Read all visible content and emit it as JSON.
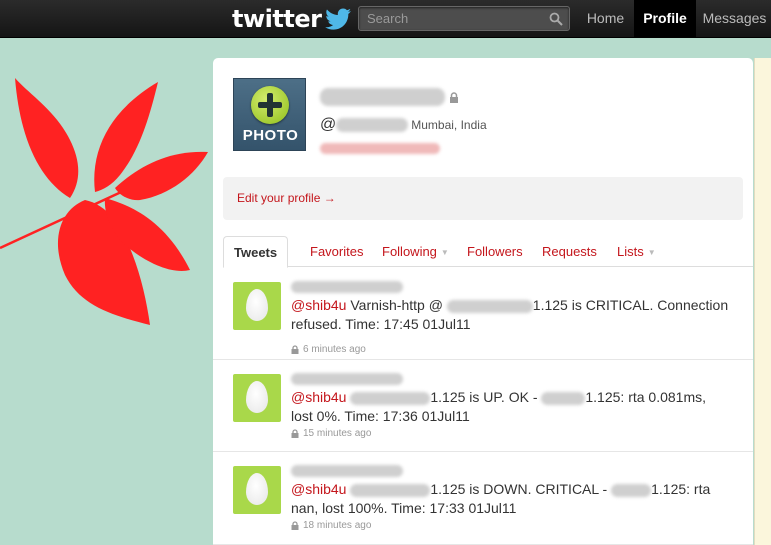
{
  "topbar": {
    "logo_text": "twitter",
    "search_placeholder": "Search",
    "nav": {
      "home": "Home",
      "profile": "Profile",
      "messages": "Messages"
    }
  },
  "profile": {
    "avatar_label": "PHOTO",
    "handle_prefix": "@",
    "location": "Mumbai, India",
    "edit_link": "Edit your profile →"
  },
  "tabs": [
    {
      "label": "Tweets"
    },
    {
      "label": "Favorites"
    },
    {
      "label": "Following"
    },
    {
      "label": "Followers"
    },
    {
      "label": "Requests"
    },
    {
      "label": "Lists"
    }
  ],
  "tweets": [
    {
      "mention": "@shib4u",
      "text_a": " Varnish-http @ ",
      "text_b": "1.125 is CRITICAL. Connection refused. Time: 17:45 01Jul11",
      "time": "6 minutes ago"
    },
    {
      "mention": "@shib4u",
      "text_b": "1.125 is UP. OK - ",
      "text_c": "1.125: rta 0.081ms, lost 0%. Time: 17:36 01Jul11",
      "time": "15 minutes ago"
    },
    {
      "mention": "@shib4u",
      "text_b": "1.125 is DOWN. CRITICAL - ",
      "text_c": "1.125: rta nan, lost 100%. Time: 17:33 01Jul11",
      "time": "18 minutes ago"
    }
  ],
  "colors": {
    "background": "#b7dccd",
    "accent_red": "#c4161c",
    "topbar": "#1e1e1e",
    "leaf": "#ff2222",
    "egg_avatar": "#a9d84a",
    "right_strip": "#fbf6dc"
  }
}
